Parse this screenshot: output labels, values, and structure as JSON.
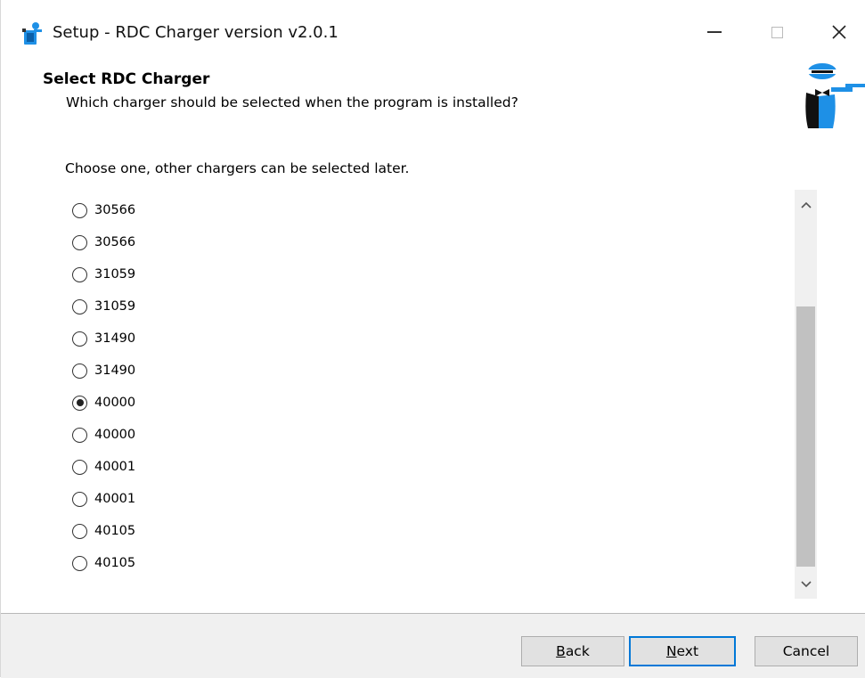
{
  "window": {
    "title": "Setup - RDC Charger version v2.0.1",
    "controls": {
      "minimize": "minimize-icon",
      "maximize": "maximize-icon",
      "close": "close-icon"
    }
  },
  "header": {
    "title": "Select RDC Charger",
    "subtitle": "Which charger should be selected when the program is installed?",
    "logo_icon": "waiter-logo-icon"
  },
  "body": {
    "instruction": "Choose one, other chargers can be selected later.",
    "options": [
      {
        "label": "30566",
        "selected": false
      },
      {
        "label": "30566",
        "selected": false
      },
      {
        "label": "31059",
        "selected": false
      },
      {
        "label": "31059",
        "selected": false
      },
      {
        "label": "31490",
        "selected": false
      },
      {
        "label": "31490",
        "selected": false
      },
      {
        "label": "40000",
        "selected": true
      },
      {
        "label": "40000",
        "selected": false
      },
      {
        "label": "40001",
        "selected": false
      },
      {
        "label": "40001",
        "selected": false
      },
      {
        "label": "40105",
        "selected": false
      },
      {
        "label": "40105",
        "selected": false
      }
    ]
  },
  "footer": {
    "back": {
      "accel": "B",
      "rest": "ack"
    },
    "next": {
      "accel": "N",
      "rest": "ext"
    },
    "cancel": "Cancel"
  },
  "colors": {
    "accent": "#0078d7",
    "logo_blue": "#1e90e6",
    "footer_bg": "#f0f0f0",
    "scroll_thumb": "#c1c1c1"
  }
}
